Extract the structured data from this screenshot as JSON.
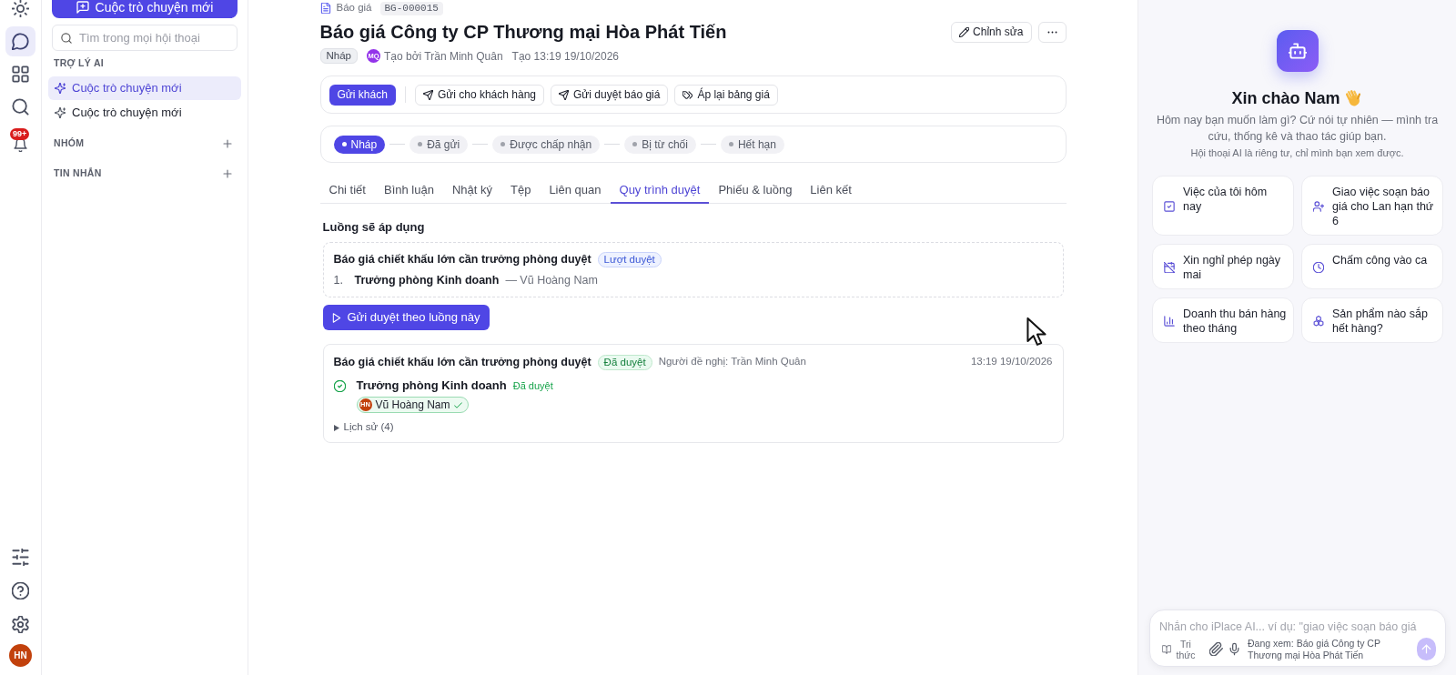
{
  "rail": {
    "items": [
      {
        "kind": "theme",
        "selected": false
      },
      {
        "kind": "chat",
        "selected": true
      },
      {
        "kind": "apps",
        "selected": false
      },
      {
        "kind": "search",
        "selected": false
      },
      {
        "kind": "notifications",
        "selected": false,
        "badge": "99+"
      }
    ],
    "bottom_items": [
      {
        "kind": "filters",
        "selected": false
      },
      {
        "kind": "help",
        "selected": false
      },
      {
        "kind": "settings",
        "selected": false
      }
    ],
    "avatar": "HN"
  },
  "sidebar": {
    "new_chat_button": "Cuộc trò chuyện mới",
    "search": {
      "placeholder": "Tìm trong mọi hội thoại"
    },
    "sections": [
      {
        "title": "TRỢ LÝ AI",
        "can_add": false,
        "items": [
          {
            "label": "Cuộc trò chuyện mới",
            "selected": true
          },
          {
            "label": "Cuộc trò chuyện mới",
            "selected": false
          }
        ]
      },
      {
        "title": "NHÓM",
        "can_add": true
      },
      {
        "title": "TIN NHẮN",
        "can_add": true
      }
    ]
  },
  "record": {
    "breadcrumb": {
      "section": "Báo giá",
      "code": "BG-000015"
    },
    "title": "Báo giá Công ty CP Thương mại Hòa Phát Tiến",
    "edit_button": "Chỉnh sửa",
    "status": "Nháp",
    "author_initials": "MQ",
    "created_by": "Tạo bởi Trần Minh Quân",
    "created_at": "Tạo 13:19 19/10/2026"
  },
  "actions": [
    {
      "kind": "primary",
      "label": "Gửi khách"
    },
    {
      "kind": "send",
      "label": "Gửi cho khách hàng"
    },
    {
      "kind": "send",
      "label": "Gửi duyệt báo giá"
    },
    {
      "kind": "tag",
      "label": "Áp lại bảng giá"
    }
  ],
  "status_steps": [
    {
      "label": "Nháp",
      "selected": true
    },
    {
      "label": "Đã gửi",
      "selected": false
    },
    {
      "label": "Được chấp nhận",
      "selected": false
    },
    {
      "label": "Bị từ chối",
      "selected": false
    },
    {
      "label": "Hết hạn",
      "selected": false
    }
  ],
  "tabs": [
    {
      "label": "Chi tiết",
      "selected": false
    },
    {
      "label": "Bình luận",
      "selected": false
    },
    {
      "label": "Nhật ký",
      "selected": false
    },
    {
      "label": "Tệp",
      "selected": false
    },
    {
      "label": "Liên quan",
      "selected": false
    },
    {
      "label": "Quy trình duyệt",
      "selected": true
    },
    {
      "label": "Phiếu & luồng",
      "selected": false
    },
    {
      "label": "Liên kết",
      "selected": false
    }
  ],
  "workflow": {
    "heading": "Luồng sẽ áp dụng",
    "flow": {
      "name": "Báo giá chiết khấu lớn cần trưởng phòng duyệt",
      "badge": "Lượt duyệt",
      "steps": [
        {
          "number": "1.",
          "role": "Trưởng phòng Kinh doanh",
          "assignee": "— Vũ Hoàng Nam"
        }
      ]
    },
    "submit_button": "Gửi duyệt theo luồng này",
    "request": {
      "name": "Báo giá chiết khấu lớn cần trưởng phòng duyệt",
      "status": "Đã duyệt",
      "approved": true,
      "requester": "Người đề nghị: Trần Minh Quân",
      "time": "13:19 19/10/2026",
      "steps": [
        {
          "role": "Trưởng phòng Kinh doanh",
          "status": "Đã duyệt",
          "approved": true,
          "approvers": [
            {
              "initials": "HN",
              "name": "Vũ Hoàng Nam",
              "approved": true
            }
          ]
        }
      ],
      "history": {
        "label": "Lịch sử (4)",
        "expanded": false
      }
    }
  },
  "assistant": {
    "greeting": "Xin chào Nam",
    "intro": "Hôm nay bạn muốn làm gì? Cứ nói tự nhiên — mình tra cứu, thống kê và thao tác giúp bạn.",
    "privacy": "Hội thoại AI là riêng tư, chỉ mình bạn xem được.",
    "suggestions": [
      {
        "kind": "task",
        "label": "Việc của tôi hôm nay"
      },
      {
        "kind": "assign",
        "label": "Giao việc soạn báo giá cho Lan hạn thứ 6"
      },
      {
        "kind": "leave",
        "label": "Xin nghỉ phép ngày mai"
      },
      {
        "kind": "attendance",
        "label": "Chấm công vào ca"
      },
      {
        "kind": "revenue",
        "label": "Doanh thu bán hàng theo tháng"
      },
      {
        "kind": "stock",
        "label": "Sản phẩm nào sắp hết hàng?"
      }
    ],
    "composer": {
      "placeholder": "Nhắn cho iPlace AI... ví dụ: \"giao việc soạn báo giá",
      "knowledge_button": "Tri thức",
      "context": "Đang xem: Báo giá Công ty CP Thương mại Hòa Phát Tiến",
      "send_disabled": true
    }
  }
}
